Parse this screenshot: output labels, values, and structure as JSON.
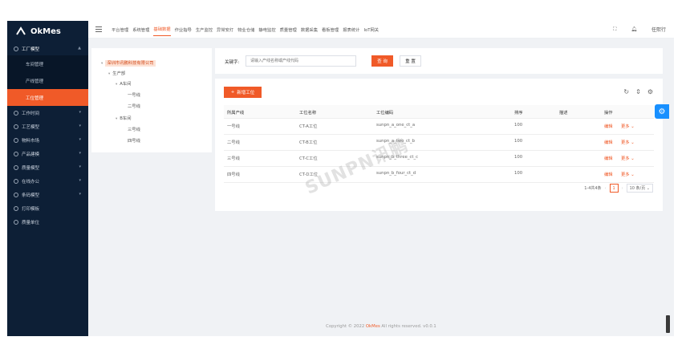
{
  "logo": {
    "text": "OkMes"
  },
  "sidebar": {
    "group_open": "工厂模型",
    "sub_items": [
      "车间管理",
      "产线管理",
      "工位管理"
    ],
    "groups": [
      "工作时间",
      "工艺模型",
      "物料市场",
      "产品建模",
      "质量模型",
      "在线办公",
      "条码模型",
      "打印模板",
      "质量单位"
    ]
  },
  "header": {
    "nav": [
      "平台管理",
      "系统管理",
      "基础数据",
      "作业指导",
      "生产监控",
      "异常安灯",
      "物业仓储",
      "静电监控",
      "质量管理",
      "数据采集",
      "看板管理",
      "报表统计",
      "IoT网关"
    ],
    "active_index": 2,
    "user": "任熙行"
  },
  "tree": {
    "root": "深圳市讯鹏科技有限公司",
    "n1": "生产部",
    "n2": "A车间",
    "a1": "一号线",
    "a2": "二号线",
    "n3": "B车间",
    "b1": "三号线",
    "b2": "四号线"
  },
  "search": {
    "label": "关键字:",
    "placeholder": "请输入产线名称或产线代码",
    "query_btn": "查 询",
    "reset_btn": "重 置"
  },
  "table": {
    "add_btn": "新增工位",
    "headers": [
      "所属产线",
      "工位名称",
      "工位编码",
      "排序",
      "描述",
      "操作"
    ],
    "rows": [
      {
        "line": "一号线",
        "name": "CT-A工位",
        "code": "sunpn_a_one_ct_a",
        "order": "100",
        "desc": "",
        "edit": "编辑",
        "more": "更多"
      },
      {
        "line": "二号线",
        "name": "CT-B工位",
        "code": "sunpn_a_two_ct_b",
        "order": "100",
        "desc": "",
        "edit": "编辑",
        "more": "更多"
      },
      {
        "line": "三号线",
        "name": "CT-C工位",
        "code": "sunpn_b_three_ct_c",
        "order": "100",
        "desc": "",
        "edit": "编辑",
        "more": "更多"
      },
      {
        "line": "四号线",
        "name": "CT-D工位",
        "code": "sunpn_b_four_ct_d",
        "order": "100",
        "desc": "",
        "edit": "编辑",
        "more": "更多"
      }
    ],
    "pager_total": "1-4共4条",
    "pager_page": "1",
    "pager_size": "10 条/页"
  },
  "footer": {
    "prefix": "Copyright © 2022",
    "brand": "OkMes",
    "suffix": "All rights reserved. v0.0.1"
  },
  "watermark": "SUNPN讯鹏",
  "colors": {
    "accent": "#f05a28",
    "sidebar": "#0d1f36",
    "info": "#1890ff"
  }
}
